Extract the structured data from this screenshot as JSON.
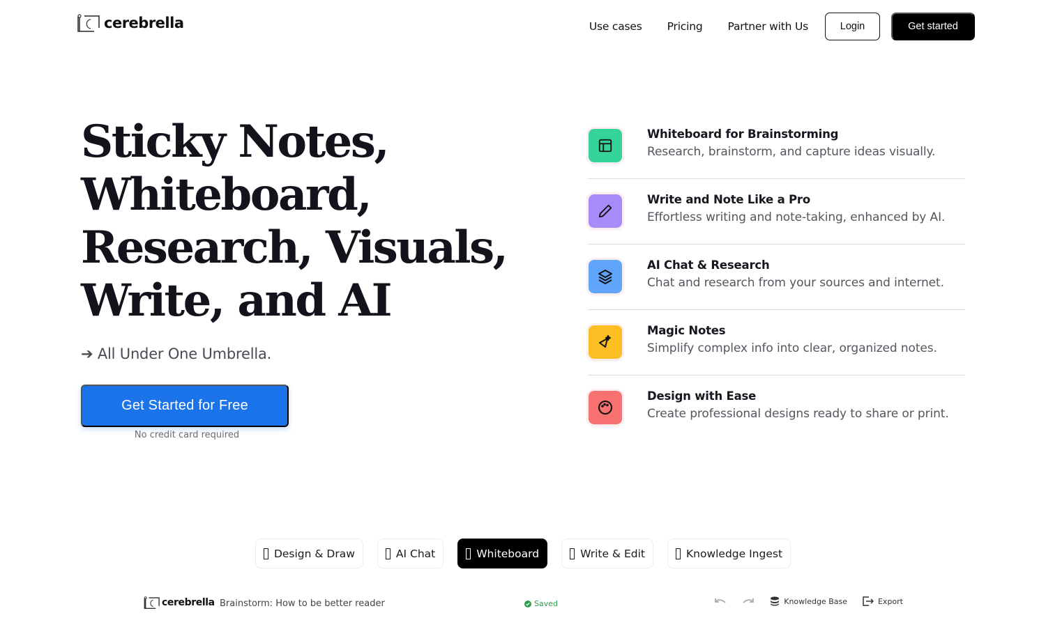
{
  "brand": {
    "name": "cerebrella"
  },
  "nav": {
    "links": [
      "Use cases",
      "Pricing",
      "Partner with Us"
    ],
    "login": "Login",
    "get_started": "Get started"
  },
  "hero": {
    "title_lines": [
      "Sticky Notes,",
      "Whiteboard,",
      "Research, Visuals,",
      "Write, and AI"
    ],
    "tagline": "➔ All Under One Umbrella.",
    "cta": "Get Started for Free",
    "cta_note": "No credit card required",
    "cta_color": "#1a73e8"
  },
  "features": [
    {
      "icon": "layout-icon",
      "color": "#34d399",
      "title": "Whiteboard for Brainstorming",
      "desc": "Research, brainstorm, and capture ideas visually."
    },
    {
      "icon": "pencil-icon",
      "color": "#a78bfa",
      "title": "Write and Note Like a Pro",
      "desc": "Effortless writing and note-taking, enhanced by AI."
    },
    {
      "icon": "layers-icon",
      "color": "#60a5fa",
      "title": "AI Chat & Research",
      "desc": "Chat and research from your sources and internet."
    },
    {
      "icon": "magic-wand-icon",
      "color": "#fbbf24",
      "title": "Magic Notes",
      "desc": "Simplify complex info into clear, organized notes."
    },
    {
      "icon": "palette-icon",
      "color": "#f87171",
      "title": "Design with Ease",
      "desc": "Create professional designs ready to share or print."
    }
  ],
  "tabs": [
    {
      "label": "Design & Draw",
      "active": false
    },
    {
      "label": "AI Chat",
      "active": false
    },
    {
      "label": "Whiteboard",
      "active": true
    },
    {
      "label": "Write & Edit",
      "active": false
    },
    {
      "label": "Knowledge Ingest",
      "active": false
    }
  ],
  "preview": {
    "brand": "cerebrella",
    "doc_title": "Brainstorm: How to be better reader",
    "status": "Saved",
    "knowledge_base": "Knowledge Base",
    "export": "Export"
  }
}
